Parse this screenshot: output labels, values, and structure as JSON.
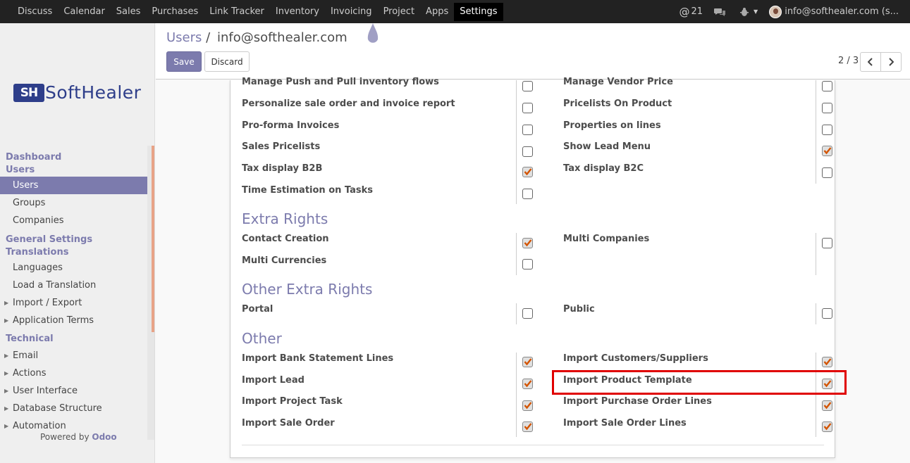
{
  "top_menu": [
    "Discuss",
    "Calendar",
    "Sales",
    "Purchases",
    "Link Tracker",
    "Inventory",
    "Invoicing",
    "Project",
    "Apps",
    "Settings"
  ],
  "active_menu": "Settings",
  "systray": {
    "mentions_count": "21",
    "user_label": "info@softhealer.com (s..."
  },
  "logo": {
    "mark": "SH",
    "text": "SoftHealer"
  },
  "sidebar": {
    "sections": [
      {
        "title": "Dashboard"
      },
      {
        "title": "Users"
      },
      {
        "item": "Users",
        "active": true
      },
      {
        "item": "Groups"
      },
      {
        "item": "Companies"
      },
      {
        "title": "General Settings"
      },
      {
        "title": "Translations"
      },
      {
        "item": "Languages"
      },
      {
        "item": "Load a Translation"
      },
      {
        "item": "Import / Export",
        "caret": true
      },
      {
        "item": "Application Terms",
        "caret": true
      },
      {
        "title": "Technical"
      },
      {
        "item": "Email",
        "caret": true
      },
      {
        "item": "Actions",
        "caret": true
      },
      {
        "item": "User Interface",
        "caret": true
      },
      {
        "item": "Database Structure",
        "caret": true
      },
      {
        "item": "Automation",
        "caret": true
      }
    ],
    "powered_by": "Powered by",
    "powered_brand": "Odoo"
  },
  "breadcrumb": {
    "parent": "Users",
    "separator": "/",
    "current": "info@softhealer.com"
  },
  "buttons": {
    "save": "Save",
    "discard": "Discard"
  },
  "pager": {
    "text": "2 / 3"
  },
  "accent_color": "#7c7bad",
  "highlight_color": "#e00000",
  "sections": {
    "extra_rights": "Extra Rights",
    "other_extra_rights": "Other Extra Rights",
    "other": "Other"
  },
  "rows_top": [
    {
      "left": "Manage Push and Pull inventory flows",
      "left_checked": false,
      "right": "Manage Vendor Price",
      "right_checked": false
    },
    {
      "left": "Personalize sale order and invoice report",
      "left_checked": false,
      "right": "Pricelists On Product",
      "right_checked": false
    },
    {
      "left": "Pro-forma Invoices",
      "left_checked": false,
      "right": "Properties on lines",
      "right_checked": false
    },
    {
      "left": "Sales Pricelists",
      "left_checked": false,
      "right": "Show Lead Menu",
      "right_checked": true
    },
    {
      "left": "Tax display B2B",
      "left_checked": true,
      "right": "Tax display B2C",
      "right_checked": false
    },
    {
      "left": "Time Estimation on Tasks",
      "left_checked": false
    }
  ],
  "rows_extra": [
    {
      "left": "Contact Creation",
      "left_checked": true,
      "right": "Multi Companies",
      "right_checked": false
    },
    {
      "left": "Multi Currencies",
      "left_checked": false
    }
  ],
  "rows_other_extra": [
    {
      "left": "Portal",
      "left_checked": false,
      "right": "Public",
      "right_checked": false
    }
  ],
  "rows_other": [
    {
      "left": "Import Bank Statement Lines",
      "left_checked": true,
      "right": "Import Customers/Suppliers",
      "right_checked": true
    },
    {
      "left": "Import Lead",
      "left_checked": true,
      "right": "Import Product Template",
      "right_checked": true
    },
    {
      "left": "Import Project Task",
      "left_checked": true,
      "right": "Import Purchase Order Lines",
      "right_checked": true
    },
    {
      "left": "Import Sale Order",
      "left_checked": true,
      "right": "Import Sale Order Lines",
      "right_checked": true
    }
  ]
}
